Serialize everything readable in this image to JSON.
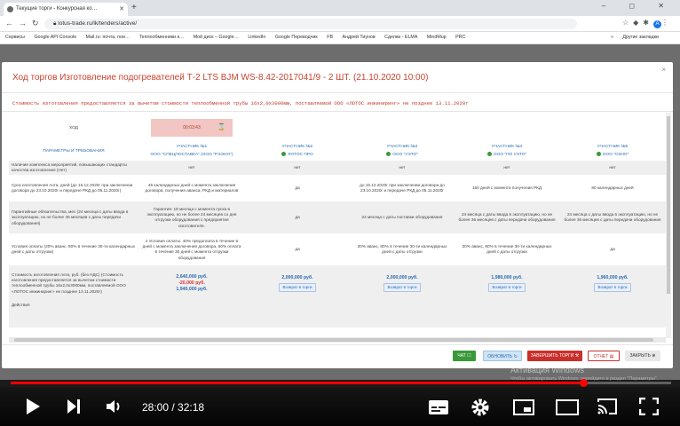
{
  "browser": {
    "tab_title": "Текущие торги - Конкурсная ко…",
    "new_tab": "+",
    "window_controls": "– ◻ ✕",
    "url": "lotus-trade.ru/lk/tenders/active/",
    "nav_icons": [
      "back-icon",
      "forward-icon",
      "reload-icon"
    ],
    "avatar_letter": "A",
    "bookmarks": [
      "Сервисы",
      "Google API Console",
      "Mail.ru: почта, пои…",
      "Теплообменники к…",
      "Мой диск – Google…",
      "LinkedIn",
      "Google Переводчик",
      "FB",
      "Андрей Тиунов",
      "Сделки - ELMA",
      "MindMup",
      "PRC"
    ],
    "bookmarks_more": "»",
    "bookmarks_other": "Другие закладки"
  },
  "modal": {
    "title_prefix": "Ход торгов ",
    "title_main": "Изготовление подогревателей Т-2 LTS BJM WS-8.42-2017041/9 - 2 ШТ. (21.10.2020 10:00)",
    "close": "×",
    "notice": "Стоимость изготовления предоставляется за вычетом стоимости теплообменной трубы 16х2,0х3000мм, поставляемой ООО «ЛОТОС инжиниринг» не позднее 13.11.2020г",
    "hod_label": "ХОД",
    "timer": "00:03:43",
    "timer_icon": "⌛",
    "params_header": "ПАРАМЕТРЫ И ТРЕБОВАНИЯ",
    "participants": [
      {
        "label": "УЧАСТНИК №1",
        "name": "ООО \"СПЕЦПОСТАВКА\" (ООО \"РЭЭНО\")",
        "green": false
      },
      {
        "label": "УЧАСТНИК №2",
        "name": "ЛОТОС ПРО",
        "green": true
      },
      {
        "label": "УЧАСТНИК №3",
        "name": "ООО \"УЭТО\"",
        "green": true
      },
      {
        "label": "УЧАСТНИК №4",
        "name": "ООО \"ПО УЭТО\"",
        "green": true
      },
      {
        "label": "УЧАСТНИК №5",
        "name": "ООО \"ОЗНО\"",
        "green": true
      }
    ],
    "rows": [
      {
        "param": "Наличие комплекса мероприятий, повышающих стандарты качества изготовления (Нет)",
        "values": [
          "нет",
          "нет",
          "нет",
          "нет",
          "нет"
        ]
      },
      {
        "param": "Срок изготовления лота, дней (до 15.12.2020г при заключении договора до 23.10.2020г и передаче РКД до 05.11.2020г)",
        "values": [
          "45 календарных дней с момента заключения договора, получения аванса, РКД и материалов",
          "да",
          "до 15.12.2020г при заключении договора до 23.10.2020г и передаче РКД до 05.11.2020г",
          "150 дней с момента получения РКД",
          "80 календарных дней"
        ]
      },
      {
        "param": "Гарантийные обязательства, мес (24 месяца с даты ввода в эксплуатацию, но не более 36 месяцев с даты передачи оборудования)",
        "values": [
          "Гарантия: 18 месяца с момента пуска в эксплуатацию, но не более 24 месяцев со дня отгрузки оборудования с предприятия изготовителя.",
          "да",
          "24 месяца с даты поставки оборудования",
          "24 месяца с даты ввода в эксплуатацию, но не более 36 месяцев с даты передачи оборудования",
          "24 месяца с даты ввода в эксплуатацию, но не более 36 месяцев с даты передачи оборудования"
        ]
      },
      {
        "param": "Условия оплаты (20% аванс, 80% в течение 30-ти календарных дней с даты отгрузки)",
        "values": [
          "2 Условия оплаты: 40% предоплата в течение 5 дней с момента заключения договора, 60% оплата в течение 30 дней с момента отгрузки оборудования",
          "да",
          "20% аванс, 80% в течение 30-ти календарных дней с даты отгрузки",
          "20% аванс, 80% в течение 30-ти календарных дней с даты отгрузки",
          "да"
        ]
      }
    ],
    "price_row": {
      "param": "Стоимость изготовления лота, руб. (без НДС) (Стоимость изготовления предоставляется за вычетом стоимости теплообменной трубы 16х2,0х3000мм, поставляемой ООО «ЛОТОС инжиниринг» не позднее 13.11.2020г)",
      "p1_base": "2,640,000 руб.",
      "p1_discount": "-20,000 руб.",
      "p1_total": "1,940,000 руб.",
      "prices": [
        "2,000,000 руб.",
        "2,000,000 руб.",
        "1,980,000 руб.",
        "1,960,000 руб."
      ],
      "return_btn": "Возврат в торги"
    },
    "actions_label": "Действия",
    "footer": {
      "chat": "ЧАТ",
      "refresh": "ОБНОВИТЬ",
      "finish": "ЗАВЕРШИТЬ ТОРГИ",
      "report": "ОТЧЕТ",
      "close": "ЗАКРЫТЬ"
    }
  },
  "watermark": {
    "line1": "Активация Windows",
    "line2": "Чтобы активировать Windows, перейдите в раздел \"Параметры\"."
  },
  "player": {
    "time": "28:00 / 32:18",
    "progress": 0.867
  }
}
